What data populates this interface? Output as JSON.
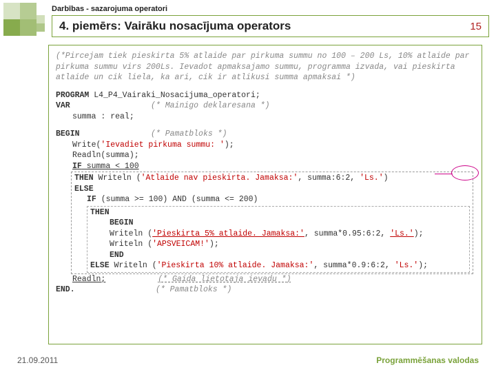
{
  "header": {
    "breadcrumb": "Darbības - sazarojuma operatori",
    "title": "4. piemērs: Vairāku nosacījuma operators",
    "page_number": "15"
  },
  "task_comment": "(*Pircejam tiek pieskirta 5% atlaide par pirkuma summu no 100 – 200 Ls, 10% atlaide par pirkuma summu virs 200Ls. Ievadot apmaksajamo summu, programma izvada, vai pieskirta atlaide un cik liela, ka ari, cik ir atlikusi summa apmaksai *)",
  "code": {
    "program_kw": "PROGRAM",
    "program_name": " L4_P4_Vairaki_Nosacijuma_operatori;",
    "var_kw": "VAR",
    "var_comment": "(* Mainigo deklaresana *)",
    "var_decl": "summa : real;",
    "begin_kw": "BEGIN",
    "begin_comment": "(* Pamatbloks *)",
    "write1a": "Write(",
    "write1s": "'Ievadiet pirkuma summu: '",
    "write1b": ");",
    "readln1": "Readln(summa);",
    "if_kw": "IF",
    "if_cond": " summa < 100",
    "then_kw": "THEN",
    "then_body1": " Writeln (",
    "then_str1": "'Atlaide nav pieskirta. Jamaksa:'",
    "then_body2": ", summa:6:2, ",
    "then_str2": "'Ls.'",
    "then_body3": ")",
    "else_kw": "ELSE",
    "if2_kw": "IF",
    "if2_cond": " (summa >= 100) AND (summa <= 200)",
    "then2_kw": "THEN",
    "begin2_kw": "BEGIN",
    "wr2a": "Writeln (",
    "wr2s1": "'Pieskirta 5% atlaide. Jamaksa:'",
    "wr2b": ", summa*0.95:6:2, ",
    "wr2s2": "'Ls.'",
    "wr2c": ");",
    "wr3a": "Writeln (",
    "wr3s": "'APSVEICAM!'",
    "wr3b": ");",
    "end2_kw": "END",
    "else2_kw": "ELSE",
    "wr4a": " Writeln (",
    "wr4s1": "'Pieskirta 10% atlaide. Jamaksa:'",
    "wr4b": ", summa*0.9:6:2, ",
    "wr4s2": "'Ls.'",
    "wr4c": ");",
    "readln2": "Readln;",
    "readln2_comment": "(* Gaida lietotaja ievadu *)",
    "end_kw": "END.",
    "end_comment": "(* Pamatbloks *)"
  },
  "footer": {
    "date": "21.09.2011",
    "course": "Programmēšanas valodas"
  }
}
